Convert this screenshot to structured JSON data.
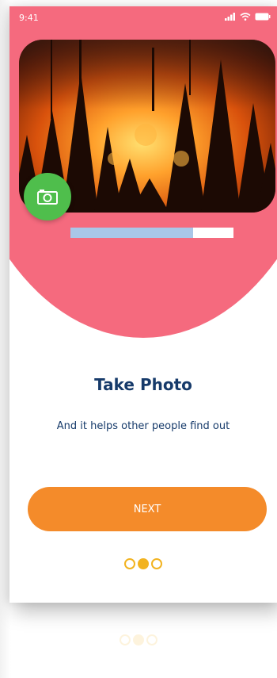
{
  "status_bar": {
    "time": "9:41",
    "icons": [
      "signal-icon",
      "wifi-icon",
      "battery-icon"
    ]
  },
  "hero": {
    "background_color": "#f56a7e",
    "image": "forest-fire-photo",
    "camera_icon": "camera-icon",
    "camera_button_color": "#4fbe4c",
    "progress": 0.75
  },
  "content": {
    "title": "Take Photo",
    "subtitle": "And it helps other people find out"
  },
  "actions": {
    "next_label": "NEXT",
    "button_color": "#f48b2a"
  },
  "pager": {
    "total": 3,
    "current": 2,
    "color": "#f2b320"
  }
}
